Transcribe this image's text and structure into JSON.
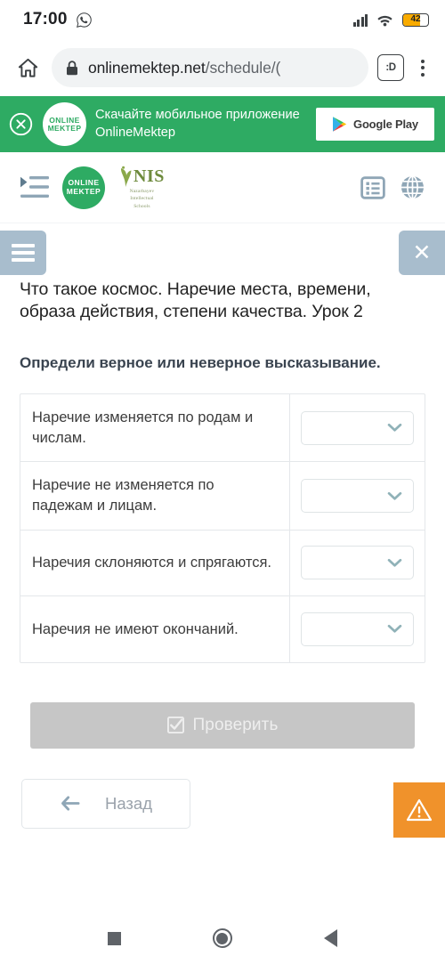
{
  "status_bar": {
    "time": "17:00",
    "whatsapp_icon": "whatsapp-icon",
    "signal_icon": "signal-bars-icon",
    "wifi_icon": "wifi-icon",
    "battery_level": "42",
    "battery_color": "#f9ab00"
  },
  "browser": {
    "home_icon": "home-icon",
    "lock_icon": "lock-icon",
    "url_domain": "onlinemektep.net",
    "url_path": "/schedule/(",
    "tabs_button_label": ":D",
    "menu_icon": "kebab-menu-icon"
  },
  "promo": {
    "close_icon": "close-circle-icon",
    "logo_line1": "ONLINE",
    "logo_line2": "MEKTEP",
    "text_line1": "Скачайте мобильное приложение",
    "text_line2": "OnlineMektep",
    "store_button_label": "Google Play",
    "background_color": "#2eab63"
  },
  "site_header": {
    "indent_icon": "indent-list-icon",
    "logo_line1": "ONLINE",
    "logo_line2": "MEKTEP",
    "nis_word": "NIS",
    "nis_sub_line1": "Nazarbayev",
    "nis_sub_line2": "Intellectual",
    "nis_sub_line3": "Schools",
    "list_icon": "list-view-icon",
    "globe_icon": "globe-icon"
  },
  "controls": {
    "menu_icon": "hamburger-menu-icon",
    "close_icon": "close-x-icon",
    "button_color": "#a8bdcd"
  },
  "lesson": {
    "title": "Что такое космос. Наречие места, времени, образа действия, степени качества. Урок 2",
    "prompt": "Определи верное или неверное высказывание."
  },
  "table": {
    "rows": [
      {
        "question": "Наречие изменяется по родам и числам.",
        "answer": ""
      },
      {
        "question": "Наречие не изменяется по падежам и лицам.",
        "answer": ""
      },
      {
        "question": "Наречия склоняются и спрягаются.",
        "answer": ""
      },
      {
        "question": "Наречия не имеют окончаний.",
        "answer": ""
      }
    ],
    "dropdown_icon": "chevron-down-icon"
  },
  "actions": {
    "check_label": "Проверить",
    "check_icon": "checkbox-checked-icon",
    "check_color": "#c6c6c6",
    "back_label": "Назад",
    "back_icon": "arrow-left-icon",
    "warning_icon": "warning-triangle-icon",
    "warning_color": "#f0922b"
  },
  "android_nav": {
    "recents_icon": "square-recents-icon",
    "home_icon": "circle-home-icon",
    "back_icon": "triangle-back-icon"
  }
}
